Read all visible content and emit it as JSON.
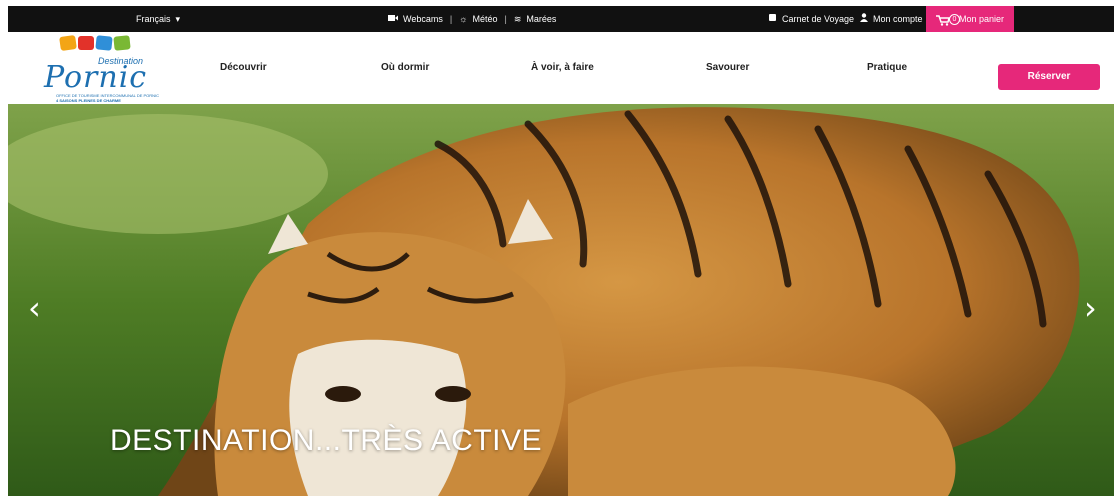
{
  "topbar": {
    "language": "Français",
    "webcams": "Webcams",
    "meteo": "Météo",
    "marees": "Marées",
    "carnet": "Carnet de Voyage",
    "compte": "Mon compte",
    "cart_label": "Mon panier",
    "cart_count": "0",
    "sep": "|"
  },
  "logo": {
    "top": "Destination",
    "name": "Pornic",
    "subline1": "OFFICE DE TOURISME INTERCOMMUNAL DE PORNIC",
    "subline2": "4 SAISONS PLEINES DE CHARME",
    "alt": "Destination Pornic"
  },
  "nav": {
    "items": [
      "Découvrir",
      "Où dormir",
      "À voir, à faire",
      "Savourer",
      "Pratique"
    ],
    "reserve": "Réserver"
  },
  "hero": {
    "title": "DESTINATION...TRÈS ACTIVE",
    "prev": "‹",
    "next": "›"
  },
  "colors": {
    "accent": "#e6287a",
    "topbar_bg": "#111111",
    "brand_blue": "#1d6fb0"
  }
}
